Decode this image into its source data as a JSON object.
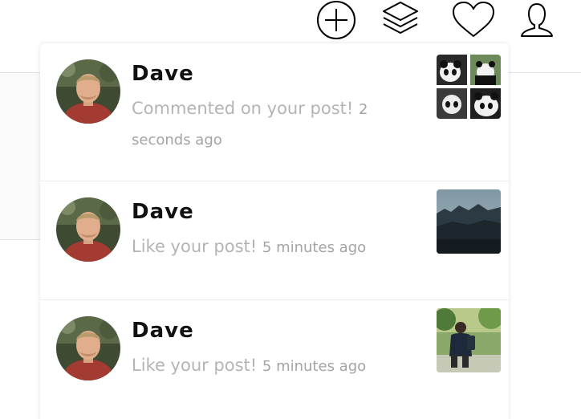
{
  "nav": {
    "icons": [
      "plus-circle-icon",
      "layers-icon",
      "heart-icon",
      "user-icon"
    ]
  },
  "notifications": [
    {
      "name": "Dave",
      "message": "Commented on your post!",
      "time": "2 seconds ago",
      "thumbnail": "panda-collage"
    },
    {
      "name": "Dave",
      "message": "Like your post!",
      "time": "5 minutes ago",
      "thumbnail": "misty-forest"
    },
    {
      "name": "Dave",
      "message": "Like your post!",
      "time": "5 minutes ago",
      "thumbnail": "person-in-park"
    }
  ],
  "colors": {
    "name_text": "#111111",
    "message_text": "#b4b4b4",
    "divider": "#ececec"
  }
}
